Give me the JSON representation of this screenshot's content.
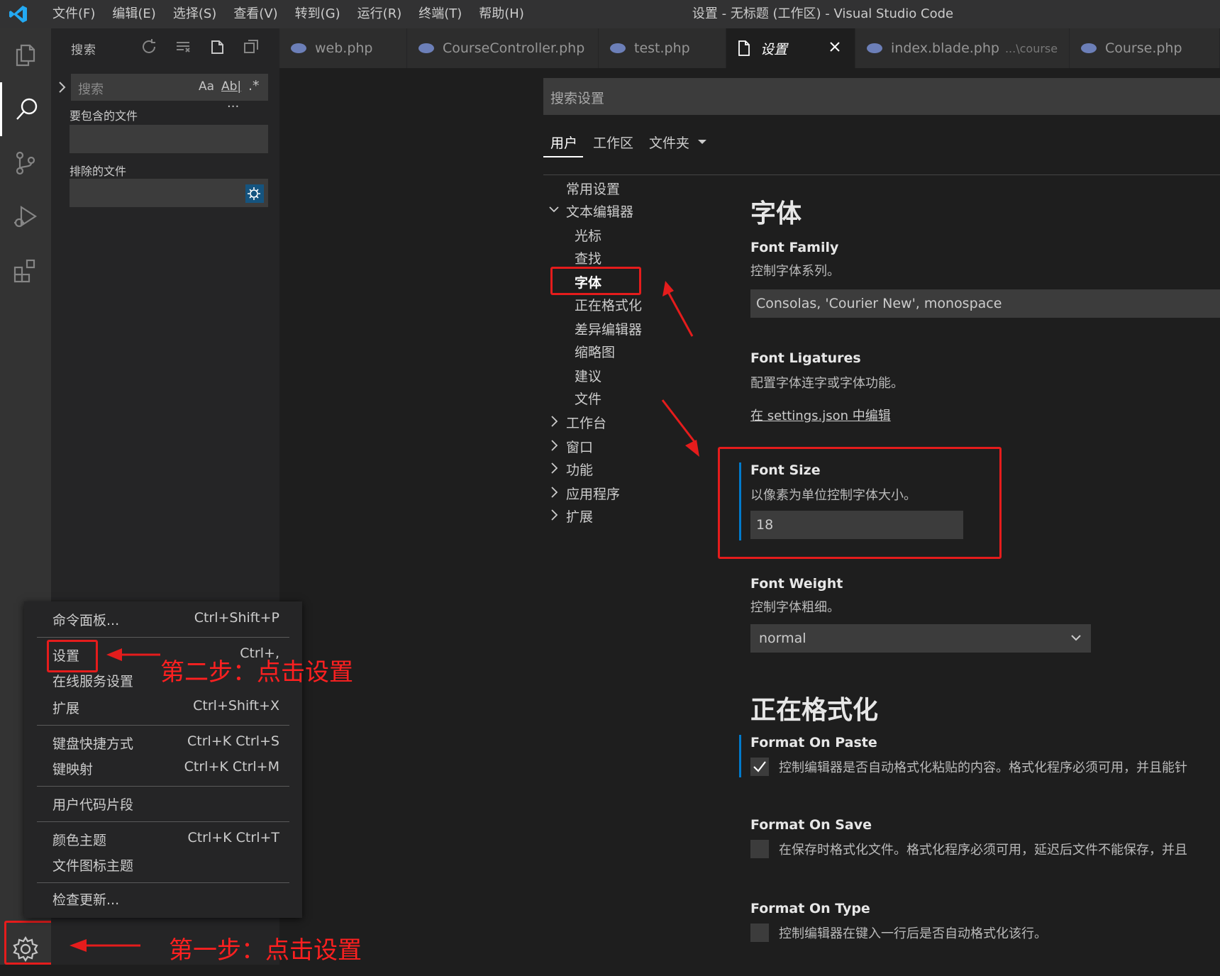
{
  "titlebar": {
    "menus": [
      "文件(F)",
      "编辑(E)",
      "选择(S)",
      "查看(V)",
      "转到(G)",
      "运行(R)",
      "终端(T)",
      "帮助(H)"
    ],
    "window_title": "设置 - 无标题 (工作区) - Visual Studio Code"
  },
  "sidebar": {
    "title": "搜索",
    "search_placeholder": "搜索",
    "match_case": "Aa",
    "whole_word": "Ab|",
    "regex": ".*",
    "include_label": "要包含的文件",
    "exclude_label": "排除的文件",
    "more": "···"
  },
  "tabs": [
    {
      "label": "web.php"
    },
    {
      "label": "CourseController.php"
    },
    {
      "label": "test.php"
    },
    {
      "label": "设置",
      "active": true
    },
    {
      "label": "index.blade.php",
      "sub": "...\\course"
    },
    {
      "label": "Course.php"
    }
  ],
  "settings": {
    "search_placeholder": "搜索设置",
    "scopes": [
      "用户",
      "工作区",
      "文件夹"
    ],
    "toc": [
      {
        "label": "常用设置"
      },
      {
        "label": "文本编辑器",
        "expanded": true
      },
      {
        "label": "光标"
      },
      {
        "label": "查找"
      },
      {
        "label": "字体",
        "active": true
      },
      {
        "label": "正在格式化"
      },
      {
        "label": "差异编辑器"
      },
      {
        "label": "缩略图"
      },
      {
        "label": "建议"
      },
      {
        "label": "文件"
      },
      {
        "label": "工作台"
      },
      {
        "label": "窗口"
      },
      {
        "label": "功能"
      },
      {
        "label": "应用程序"
      },
      {
        "label": "扩展"
      }
    ],
    "font_section": {
      "title": "字体",
      "family_title": "Font Family",
      "family_desc": "控制字体系列。",
      "family_value": "Consolas, 'Courier New', monospace",
      "ligatures_title": "Font Ligatures",
      "ligatures_desc": "配置字体连字或字体功能。",
      "ligatures_link": "在 settings.json 中编辑",
      "size_title": "Font Size",
      "size_desc": "以像素为单位控制字体大小。",
      "size_value": "18",
      "weight_title": "Font Weight",
      "weight_desc": "控制字体粗细。",
      "weight_value": "normal"
    },
    "format_section": {
      "title": "正在格式化",
      "paste_title": "Format On Paste",
      "paste_desc": "控制编辑器是否自动格式化粘贴的内容。格式化程序必须可用，并且能针",
      "paste_checked": true,
      "save_title": "Format On Save",
      "save_desc": "在保存时格式化文件。格式化程序必须可用，延迟后文件不能保存，并且",
      "save_checked": false,
      "type_title": "Format On Type",
      "type_desc": "控制编辑器在键入一行后是否自动格式化该行。",
      "type_checked": false
    }
  },
  "menu": {
    "items": [
      {
        "label": "命令面板...",
        "key": "Ctrl+Shift+P"
      },
      {
        "label": "设置",
        "key": "Ctrl+,"
      },
      {
        "label": "在线服务设置",
        "key": ""
      },
      {
        "label": "扩展",
        "key": "Ctrl+Shift+X"
      },
      {
        "label": "键盘快捷方式",
        "key": "Ctrl+K Ctrl+S"
      },
      {
        "label": "键映射",
        "key": "Ctrl+K Ctrl+M"
      },
      {
        "label": "用户代码片段",
        "key": ""
      },
      {
        "label": "颜色主题",
        "key": "Ctrl+K Ctrl+T"
      },
      {
        "label": "文件图标主题",
        "key": ""
      },
      {
        "label": "检查更新...",
        "key": ""
      }
    ]
  },
  "annotations": {
    "step1": "第一步：点击设置",
    "step2": "第二步：点击设置"
  },
  "colors": {
    "accent": "#007acc",
    "annotation_red": "#e51c1c",
    "background": "#1e1e1e"
  }
}
